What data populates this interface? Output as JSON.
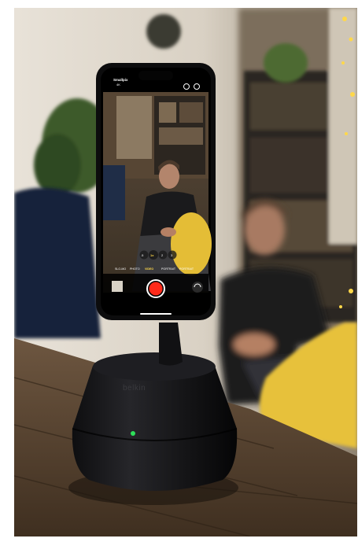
{
  "photo": {
    "subject": "Belkin phone mount tracking a seated man, with a smartphone showing a camera app",
    "brand_mark": "belkin",
    "phone_ui": {
      "top_left_label": "Smallpix",
      "top_left_sublabel": "4K",
      "modes": [
        "SLO-MO",
        "PHOTO",
        "VIDEO",
        "PORTRAIT",
        "PORTRAIT"
      ],
      "selected_mode": "VIDEO",
      "zoom_options": [
        ".5",
        "1x",
        "2",
        "3"
      ],
      "selected_zoom": "1x",
      "record_button_color": "#ff2a1a",
      "status_light_color": "#2ee05a"
    }
  }
}
